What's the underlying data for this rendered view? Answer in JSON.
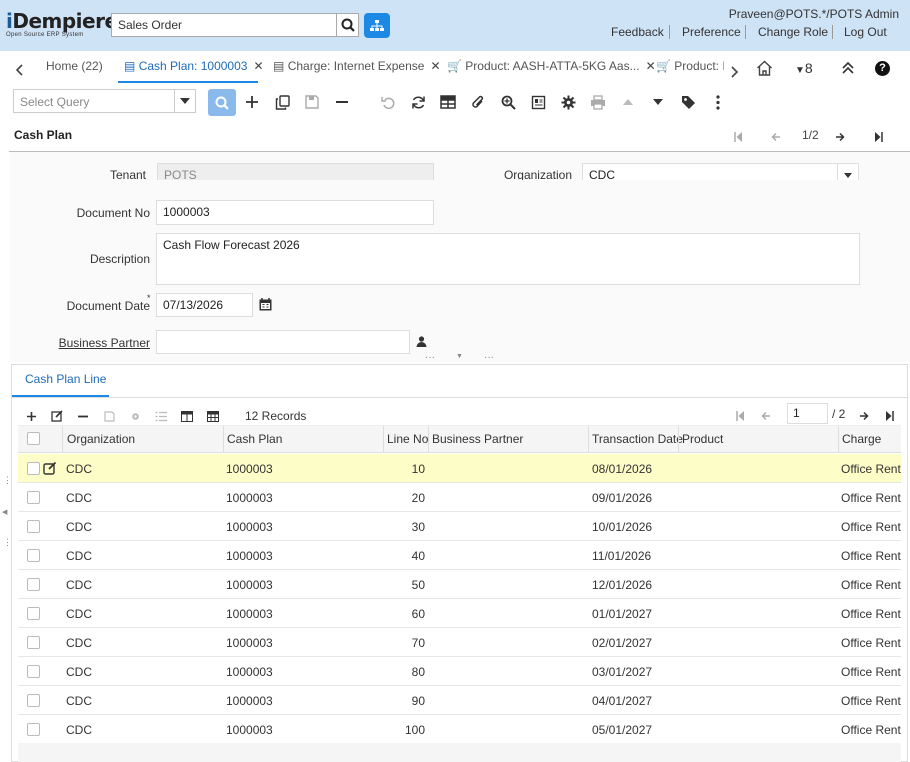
{
  "header": {
    "logo_text": "iDempiere",
    "logo_i": "i",
    "logo_rest": "Dempiere",
    "logo_sub": "Open Source ERP System",
    "search_value": "Sales Order",
    "user": "Praveen@POTS.*/POTS Admin",
    "links": [
      "Feedback",
      "Preference",
      "Change Role",
      "Log Out"
    ]
  },
  "tabs": {
    "home": "Home (22)",
    "cash_plan": "Cash Plan: 1000003",
    "charge": "Charge: Internet Expense",
    "product1": "Product: AASH-ATTA-5KG Aas...",
    "product2": "Product: I",
    "count": "8"
  },
  "toolbar": {
    "query_placeholder": "Select Query"
  },
  "window": {
    "title": "Cash Plan",
    "record_nav": "1/2"
  },
  "form": {
    "tenant_label": "Tenant",
    "tenant_value": "POTS",
    "org_label": "Organization",
    "org_value": "CDC",
    "docno_label": "Document No",
    "docno_value": "1000003",
    "desc_label": "Description",
    "desc_value": "Cash Flow Forecast 2026",
    "date_label": "Document Date",
    "date_value": "07/13/2026",
    "bp_label": "Business Partner",
    "bp_value": ""
  },
  "detail": {
    "tab_label": "Cash Plan Line",
    "records": "12 Records",
    "page_value": "1",
    "page_total": "/ 2",
    "columns": [
      "Organization",
      "Cash Plan",
      "Line No",
      "Business Partner",
      "Transaction Date",
      "Product",
      "Charge"
    ],
    "rows": [
      {
        "org": "CDC",
        "plan": "1000003",
        "line": "10",
        "bp": "",
        "date": "08/01/2026",
        "product": "",
        "charge": "Office Rent"
      },
      {
        "org": "CDC",
        "plan": "1000003",
        "line": "20",
        "bp": "",
        "date": "09/01/2026",
        "product": "",
        "charge": "Office Rent"
      },
      {
        "org": "CDC",
        "plan": "1000003",
        "line": "30",
        "bp": "",
        "date": "10/01/2026",
        "product": "",
        "charge": "Office Rent"
      },
      {
        "org": "CDC",
        "plan": "1000003",
        "line": "40",
        "bp": "",
        "date": "11/01/2026",
        "product": "",
        "charge": "Office Rent"
      },
      {
        "org": "CDC",
        "plan": "1000003",
        "line": "50",
        "bp": "",
        "date": "12/01/2026",
        "product": "",
        "charge": "Office Rent"
      },
      {
        "org": "CDC",
        "plan": "1000003",
        "line": "60",
        "bp": "",
        "date": "01/01/2027",
        "product": "",
        "charge": "Office Rent"
      },
      {
        "org": "CDC",
        "plan": "1000003",
        "line": "70",
        "bp": "",
        "date": "02/01/2027",
        "product": "",
        "charge": "Office Rent"
      },
      {
        "org": "CDC",
        "plan": "1000003",
        "line": "80",
        "bp": "",
        "date": "03/01/2027",
        "product": "",
        "charge": "Office Rent"
      },
      {
        "org": "CDC",
        "plan": "1000003",
        "line": "90",
        "bp": "",
        "date": "04/01/2027",
        "product": "",
        "charge": "Office Rent"
      },
      {
        "org": "CDC",
        "plan": "1000003",
        "line": "100",
        "bp": "",
        "date": "05/01/2027",
        "product": "",
        "charge": "Office Rent"
      }
    ]
  },
  "colors": {
    "accent": "#1e88e5",
    "header_bg": "#cfe3f6",
    "selected_row": "#fdfdc8"
  }
}
